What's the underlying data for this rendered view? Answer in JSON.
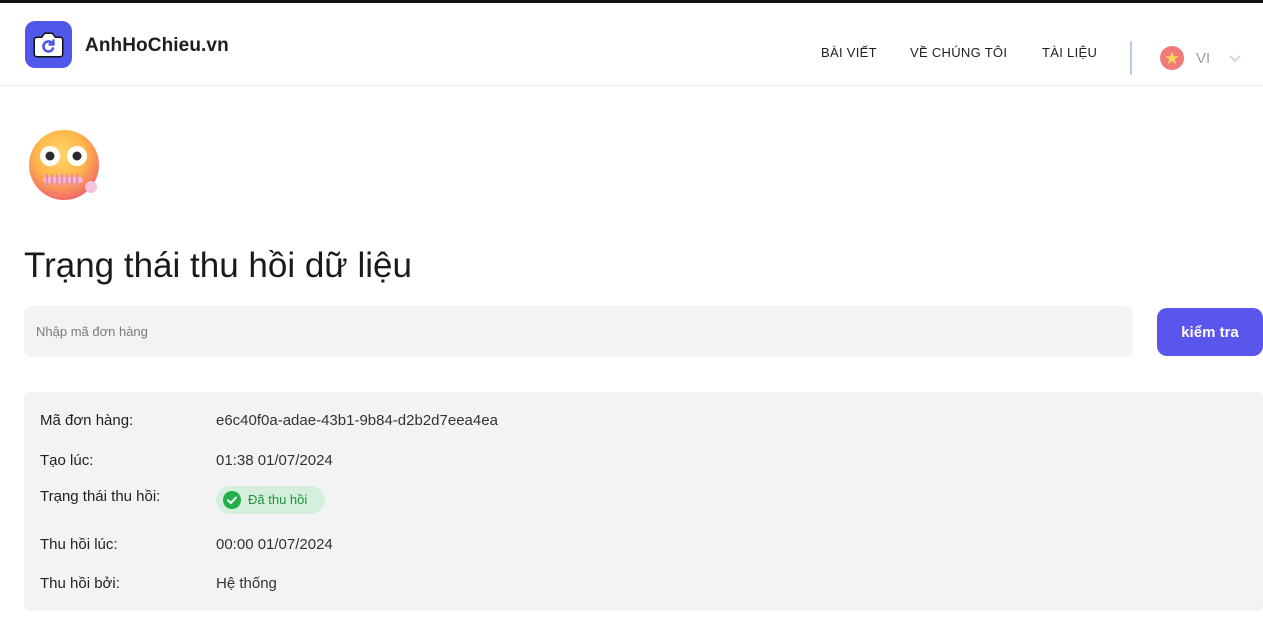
{
  "header": {
    "brand": "AnhHoChieu.vn",
    "nav": [
      {
        "label": "BÀI VIẾT"
      },
      {
        "label": "VỀ CHÚNG TÔI"
      },
      {
        "label": "TÀI LIỆU"
      }
    ],
    "language": "VI",
    "icons": {
      "logo": "camera-refresh-icon",
      "flag": "vietnam-flag-icon",
      "dropdown": "chevron-down-icon"
    },
    "accent": "#4f58e8"
  },
  "main": {
    "emoji": "zipper-mouth-face-icon",
    "title": "Trạng thái thu hồi dữ liệu",
    "search": {
      "placeholder": "Nhập mã đơn hàng",
      "value": ""
    },
    "check_button": "kiểm tra",
    "details": {
      "order_id_label": "Mã đơn hàng:",
      "order_id": "e6c40f0a-adae-43b1-9b84-d2b2d7eea4ea",
      "created_label": "Tạo lúc:",
      "created": "01:38 01/07/2024",
      "status_label": "Trạng thái thu hồi:",
      "status": "Đã thu hồi",
      "status_color": "#23913f",
      "revoked_at_label": "Thu hồi lúc:",
      "revoked_at": "00:00 01/07/2024",
      "revoked_by_label": "Thu hồi bởi:",
      "revoked_by": "Hệ thống"
    }
  }
}
